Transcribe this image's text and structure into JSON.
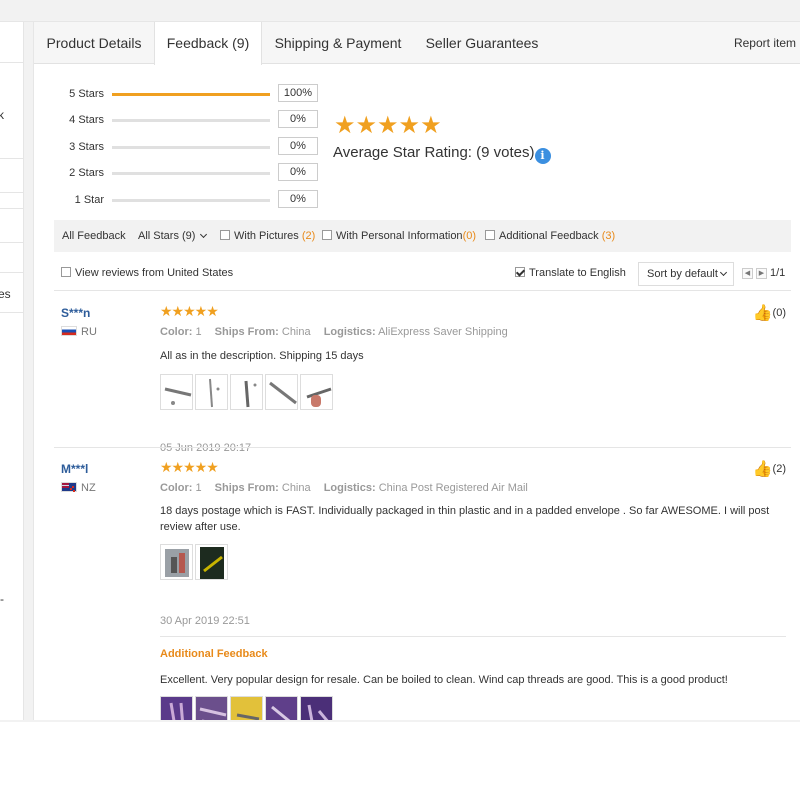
{
  "sidebar_fragments": [
    "k",
    "es",
    "-"
  ],
  "tabs": [
    {
      "label": "Product Details",
      "active": false
    },
    {
      "label": "Feedback (9)",
      "active": true
    },
    {
      "label": "Shipping & Payment",
      "active": false
    },
    {
      "label": "Seller Guarantees",
      "active": false
    }
  ],
  "report_item": "Report item",
  "ratings": [
    {
      "label": "5 Stars",
      "percent": "100%",
      "fill": 1.0
    },
    {
      "label": "4 Stars",
      "percent": "0%",
      "fill": 0
    },
    {
      "label": "3 Stars",
      "percent": "0%",
      "fill": 0
    },
    {
      "label": "2 Stars",
      "percent": "0%",
      "fill": 0
    },
    {
      "label": "1 Star",
      "percent": "0%",
      "fill": 0
    }
  ],
  "average": {
    "stars": "★★★★★",
    "label": "Average Star Rating:",
    "votes": "(9 votes)",
    "info_glyph": "i"
  },
  "filters": {
    "all_feedback": "All Feedback",
    "all_stars": "All Stars (9)",
    "with_pictures": "With Pictures",
    "with_pictures_count": "(2)",
    "with_personal": "With Personal Information",
    "with_personal_count": "(0)",
    "additional": "Additional Feedback",
    "additional_count": "(3)"
  },
  "options": {
    "view_us": "View reviews from United States",
    "translate": "Translate to English",
    "sort": "Sort by default",
    "prev_glyph": "◀",
    "next_glyph": "▶",
    "page": "1/1"
  },
  "reviews": [
    {
      "user": "S***n",
      "country": "RU",
      "stars": "★★★★★",
      "color_label": "Color:",
      "color": "1",
      "ships_label": "Ships From:",
      "ships": "China",
      "logistics_label": "Logistics:",
      "logistics": "AliExpress Saver Shipping",
      "text": "All as in the description. Shipping 15 days",
      "date": "05 Jun 2019 20:17",
      "likes": "(0)"
    },
    {
      "user": "M***l",
      "country": "NZ",
      "stars": "★★★★★",
      "color_label": "Color:",
      "color": "1",
      "ships_label": "Ships From:",
      "ships": "China",
      "logistics_label": "Logistics:",
      "logistics": "China Post Registered Air Mail",
      "text": "18 days postage which is FAST. Individually packaged in thin plastic and in a padded envelope . So far AWESOME. I will post review after use.",
      "date": "30 Apr 2019 22:51",
      "likes": "(2)",
      "additional_title": "Additional Feedback",
      "additional_text": "Excellent. Very popular design for resale. Can be boiled to clean. Wind cap threads are good. This is a good product!"
    }
  ],
  "like_glyph": "👍"
}
